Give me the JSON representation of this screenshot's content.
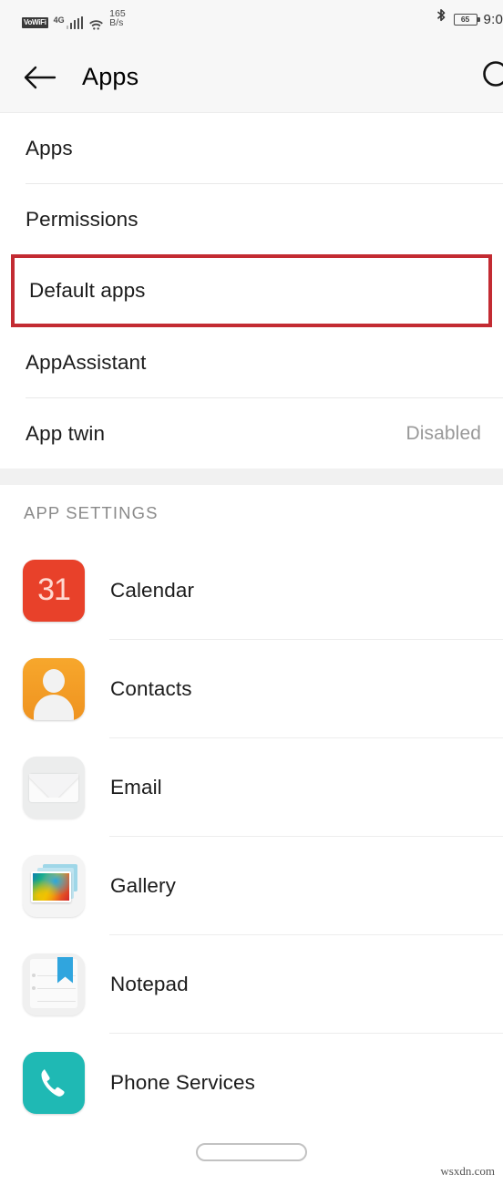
{
  "status_bar": {
    "vowifi_label": "VoWiFi",
    "network_type": "4G",
    "signal_icon": "signal-bars-icon",
    "wifi_icon": "wifi-icon",
    "data_rate_value": "165",
    "data_rate_unit": "B/s",
    "bluetooth_icon": "bluetooth-icon",
    "battery_percent": "65",
    "time": "9:0"
  },
  "app_bar": {
    "back_icon": "back-arrow-icon",
    "title": "Apps",
    "search_icon": "search-icon"
  },
  "settings": {
    "items": [
      {
        "label": "Apps",
        "value": ""
      },
      {
        "label": "Permissions",
        "value": ""
      },
      {
        "label": "Default apps",
        "value": "",
        "highlighted": true
      },
      {
        "label": "AppAssistant",
        "value": ""
      },
      {
        "label": "App twin",
        "value": "Disabled"
      }
    ]
  },
  "app_settings": {
    "header": "APP SETTINGS",
    "apps": [
      {
        "name": "Calendar",
        "icon": "calendar-icon",
        "icon_text": "31",
        "color": "#e8412a"
      },
      {
        "name": "Contacts",
        "icon": "contacts-icon",
        "color": "#f4a029"
      },
      {
        "name": "Email",
        "icon": "email-icon",
        "color": "#eceded"
      },
      {
        "name": "Gallery",
        "icon": "gallery-icon",
        "color": "#f4f4f4"
      },
      {
        "name": "Notepad",
        "icon": "notepad-icon",
        "color": "#f0f0f0"
      },
      {
        "name": "Phone Services",
        "icon": "phone-icon",
        "color": "#1fb9b4"
      }
    ]
  },
  "navigation": {
    "gesture_pill": "home-gesture-pill"
  },
  "watermark": "wsxdn.com",
  "colors": {
    "highlight_border": "#c32b32",
    "background": "#ffffff",
    "bar_background": "#f7f7f7",
    "section_band": "#f1f1f1",
    "secondary_text": "#999999"
  }
}
